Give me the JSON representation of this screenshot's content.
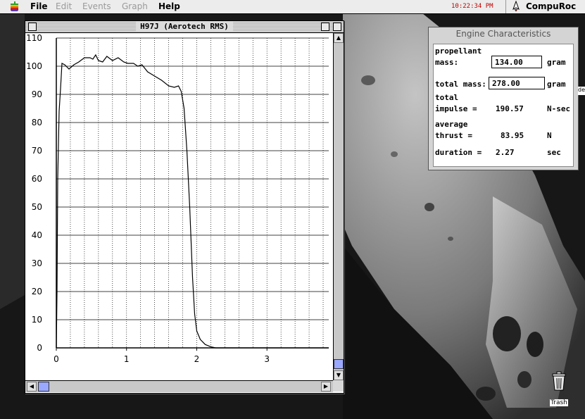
{
  "menubar": {
    "menus": [
      "File",
      "Edit",
      "Events",
      "Graph",
      "Help"
    ],
    "clock": "10:22:34 PM",
    "app_name": "CompuRoc"
  },
  "graph_window": {
    "title": "H97J (Aerotech RMS)"
  },
  "engine_panel": {
    "title": "Engine Characteristics",
    "propellant_label_1": "propellant",
    "propellant_label_2": "mass:",
    "propellant_value": "134.00",
    "propellant_unit": "gram",
    "total_mass_label": "total mass:",
    "total_mass_value": "278.00",
    "total_mass_unit": "gram",
    "total_impulse_label_1": "total",
    "total_impulse_label_2": "impulse  =",
    "total_impulse_value": "190.57",
    "total_impulse_unit": "N-sec",
    "average_thrust_label_1": "average",
    "average_thrust_label_2": "thrust   =",
    "average_thrust_value": "83.95",
    "average_thrust_unit": "N",
    "duration_label": "duration =",
    "duration_value": "2.27",
    "duration_unit": "sec"
  },
  "desktop": {
    "trash_label": "Trash",
    "edge_label": "de"
  },
  "colors": {
    "clock": "#c00000",
    "scroll_thumb": "#9aa8ff"
  },
  "chart_data": {
    "type": "line",
    "title": "",
    "xlabel": "",
    "ylabel": "",
    "xlim": [
      0,
      3.88
    ],
    "ylim": [
      0,
      110
    ],
    "x_ticks": [
      0,
      1,
      2,
      3
    ],
    "y_ticks": [
      0,
      10,
      20,
      30,
      40,
      50,
      60,
      70,
      80,
      90,
      100,
      110
    ],
    "grid": true,
    "series": [
      {
        "points": [
          [
            0.0,
            0
          ],
          [
            0.01,
            20
          ],
          [
            0.02,
            60
          ],
          [
            0.04,
            84
          ],
          [
            0.06,
            92
          ],
          [
            0.08,
            101
          ],
          [
            0.12,
            100.5
          ],
          [
            0.18,
            99
          ],
          [
            0.25,
            100.5
          ],
          [
            0.32,
            101.5
          ],
          [
            0.4,
            103
          ],
          [
            0.48,
            103
          ],
          [
            0.52,
            102.5
          ],
          [
            0.56,
            104
          ],
          [
            0.6,
            102
          ],
          [
            0.66,
            101.5
          ],
          [
            0.72,
            103.5
          ],
          [
            0.8,
            102
          ],
          [
            0.88,
            103
          ],
          [
            0.96,
            101.5
          ],
          [
            1.02,
            101
          ],
          [
            1.1,
            101
          ],
          [
            1.16,
            100
          ],
          [
            1.22,
            100.5
          ],
          [
            1.3,
            98
          ],
          [
            1.4,
            96.5
          ],
          [
            1.5,
            95
          ],
          [
            1.6,
            93
          ],
          [
            1.68,
            92.5
          ],
          [
            1.74,
            93
          ],
          [
            1.78,
            91
          ],
          [
            1.82,
            85
          ],
          [
            1.86,
            70
          ],
          [
            1.9,
            50
          ],
          [
            1.94,
            25
          ],
          [
            1.97,
            12
          ],
          [
            2.0,
            6
          ],
          [
            2.05,
            3
          ],
          [
            2.12,
            1.2
          ],
          [
            2.2,
            0.4
          ],
          [
            2.27,
            0
          ],
          [
            3.88,
            0
          ]
        ]
      }
    ]
  }
}
